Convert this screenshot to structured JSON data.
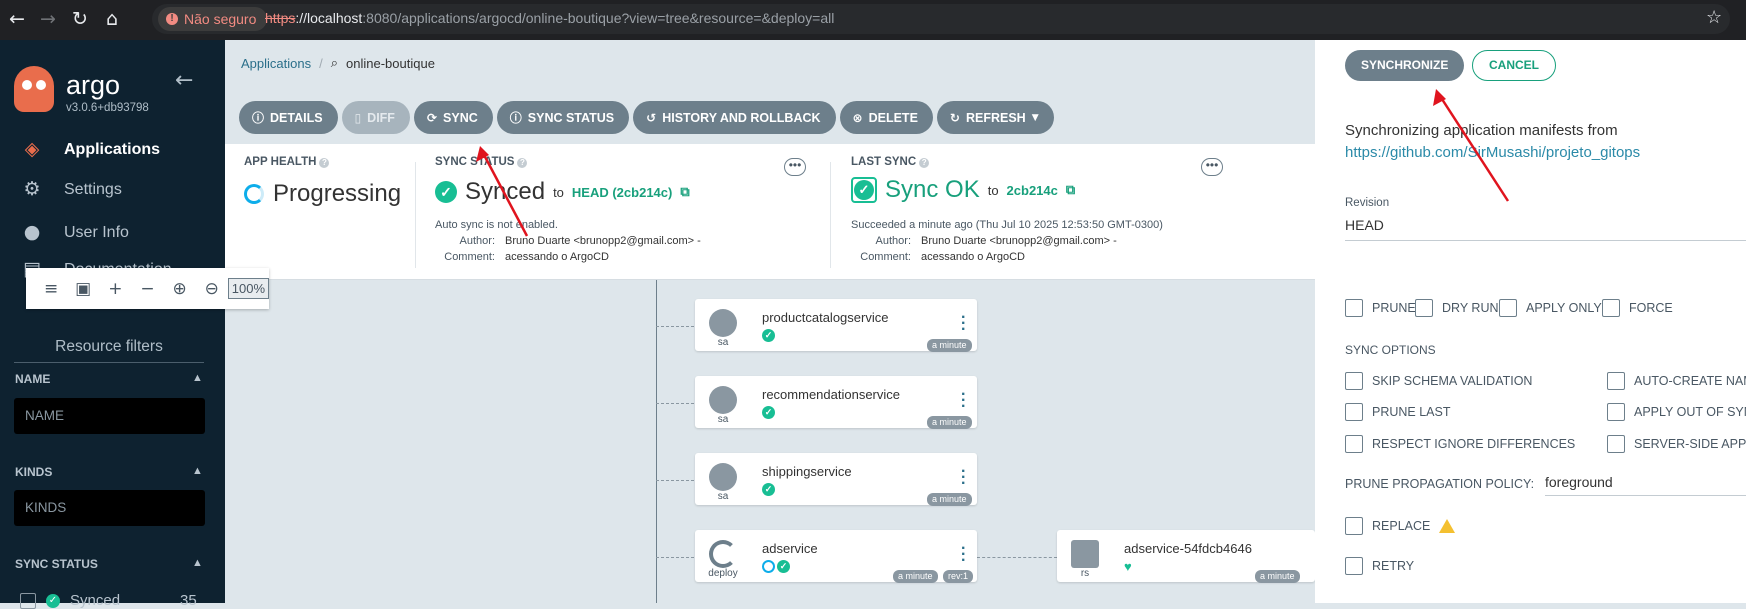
{
  "browser": {
    "insecure_label": "Não seguro",
    "url_proto": "https",
    "url_host": "://localhost",
    "url_rest": ":8080/applications/argocd/online-boutique?view=tree&resource=&deploy=all"
  },
  "sidebar": {
    "brand": "argo",
    "version": "v3.0.6+db93798",
    "items": [
      {
        "label": "Applications",
        "icon": "layers-icon"
      },
      {
        "label": "Settings",
        "icon": "gear-icon"
      },
      {
        "label": "User Info",
        "icon": "user-icon"
      },
      {
        "label": "Documentation",
        "icon": "book-icon"
      }
    ],
    "filters_title": "Resource filters",
    "name_label": "NAME",
    "name_placeholder": "NAME",
    "kinds_label": "KINDS",
    "kinds_placeholder": "KINDS",
    "sync_status_label": "SYNC STATUS",
    "synced_label": "Synced",
    "synced_count": "35"
  },
  "breadcrumb": {
    "root": "Applications",
    "current": "online-boutique"
  },
  "toolbar": {
    "details": "DETAILS",
    "diff": "DIFF",
    "sync": "SYNC",
    "sync_status": "SYNC STATUS",
    "history": "HISTORY AND ROLLBACK",
    "delete": "DELETE",
    "refresh": "REFRESH"
  },
  "status": {
    "app_health_label": "APP HEALTH",
    "app_health_value": "Progressing",
    "sync_status_label": "SYNC STATUS",
    "sync_status_value": "Synced",
    "sync_to": "to",
    "sync_rev": "HEAD (2cb214c)",
    "auto_sync_note": "Auto sync is not enabled.",
    "author_key": "Author:",
    "author_val": "Bruno Duarte <brunopp2@gmail.com> -",
    "comment_key": "Comment:",
    "comment_val": "acessando o ArgoCD",
    "last_sync_label": "LAST SYNC",
    "last_sync_value": "Sync OK",
    "last_sync_to": "to",
    "last_sync_rev": "2cb214c",
    "last_sync_note": "Succeeded a minute ago (Thu Jul 10 2025 12:53:50 GMT-0300)",
    "ls_author_key": "Author:",
    "ls_author_val": "Bruno Duarte <brunopp2@gmail.com> -",
    "ls_comment_key": "Comment:",
    "ls_comment_val": "acessando o ArgoCD"
  },
  "zoom": {
    "percent": "100%"
  },
  "tree": {
    "nodes": [
      {
        "name": "productcatalogservice",
        "kind": "sa",
        "tags": [
          "a minute"
        ]
      },
      {
        "name": "recommendationservice",
        "kind": "sa",
        "tags": [
          "a minute"
        ]
      },
      {
        "name": "shippingservice",
        "kind": "sa",
        "tags": [
          "a minute"
        ]
      },
      {
        "name": "adservice",
        "kind": "deploy",
        "tags": [
          "a minute",
          "rev:1"
        ]
      },
      {
        "name": "adservice-54fdcb4646",
        "kind": "rs",
        "tags": [
          "a minute"
        ]
      }
    ]
  },
  "sync_panel": {
    "synchronize": "SYNCHRONIZE",
    "cancel": "CANCEL",
    "intro": "Synchronizing application manifests from",
    "repo": "https://github.com/SirMusashi/projeto_gitops",
    "revision_label": "Revision",
    "revision_value": "HEAD",
    "prune": "PRUNE",
    "dry_run": "DRY RUN",
    "apply_only": "APPLY ONLY",
    "force": "FORCE",
    "sync_options_label": "SYNC OPTIONS",
    "skip_schema": "SKIP SCHEMA VALIDATION",
    "auto_create": "AUTO-CREATE NAMESPACE",
    "prune_last": "PRUNE LAST",
    "apply_out_of_sync": "APPLY OUT OF SYNC ONLY",
    "respect_ignore": "RESPECT IGNORE DIFFERENCES",
    "server_side": "SERVER-SIDE APPLY",
    "ppp_label": "PRUNE PROPAGATION POLICY:",
    "ppp_value": "foreground",
    "replace": "REPLACE",
    "retry": "RETRY"
  }
}
